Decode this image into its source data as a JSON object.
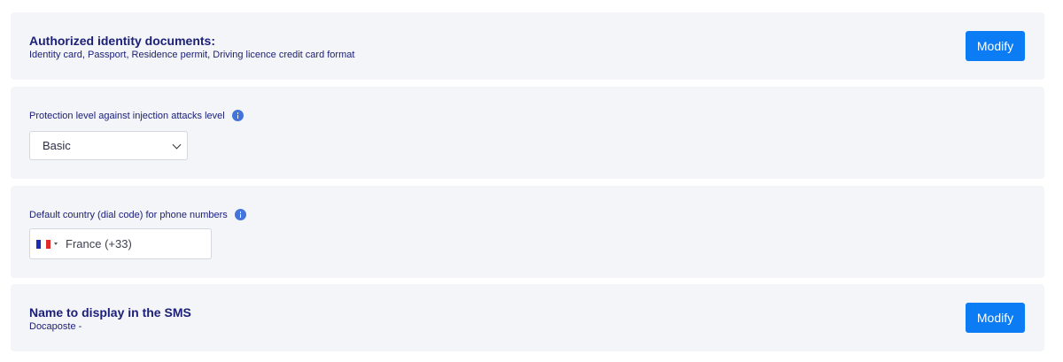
{
  "sections": {
    "identity_docs": {
      "title": "Authorized identity documents:",
      "subtitle": "Identity card, Passport, Residence permit, Driving licence credit card format",
      "button": "Modify"
    },
    "protection": {
      "label": "Protection level against injection attacks level",
      "selected": "Basic"
    },
    "country": {
      "label": "Default country (dial code) for phone numbers",
      "value": "France (+33)"
    },
    "sms_name": {
      "title": "Name to display in the SMS",
      "subtitle": "Docaposte -",
      "button": "Modify"
    }
  },
  "colors": {
    "accent": "#0b7cf4",
    "text": "#1c2079",
    "card_bg": "#f4f5f8",
    "info_icon": "#4374d9"
  },
  "icons": [
    "info-icon",
    "chevron-down-icon",
    "france-flag-icon",
    "caret-down-icon"
  ]
}
